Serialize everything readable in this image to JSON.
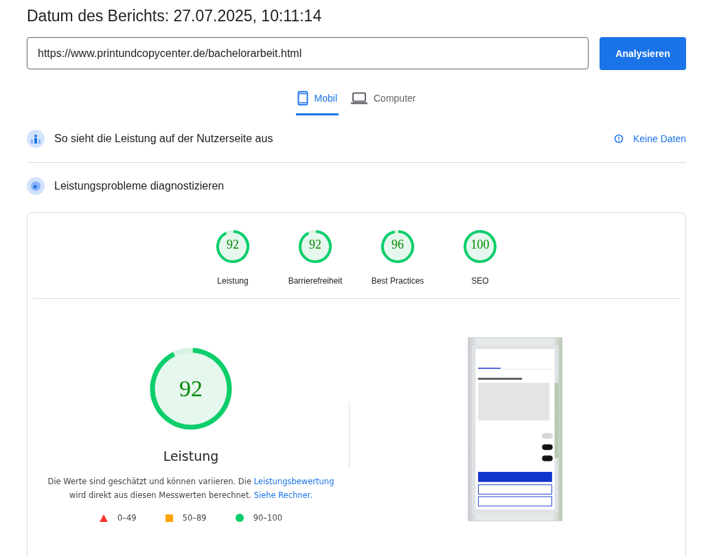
{
  "header": {
    "title": "Datum des Berichts: 27.07.2025, 10:11:14"
  },
  "url_field": {
    "value": "https://www.printundcopycenter.de/bachelorarbeit.html"
  },
  "analyze_button": {
    "label": "Analysieren"
  },
  "tabs": [
    {
      "label": "Mobil",
      "kind": "phone",
      "selected": true
    },
    {
      "label": "Computer",
      "kind": "laptop",
      "selected": false
    }
  ],
  "field_data": {
    "title": "So sieht die Leistung auf der Nutzerseite aus",
    "link": "Keine Daten"
  },
  "diagnostics": {
    "title": "Leistungsprobleme diagnostizieren",
    "categories": [
      {
        "score": "92",
        "label": "Leistung",
        "level": 0.92
      },
      {
        "score": "92",
        "label": "Barrierefreiheit",
        "level": 0.92
      },
      {
        "score": "96",
        "label": "Best Practices",
        "level": 0.96
      },
      {
        "score": "100",
        "label": "SEO",
        "level": 1
      }
    ],
    "main_gauge": {
      "score": "92",
      "label": "Leistung",
      "level": 0.92
    },
    "note": {
      "text": "Die Werte sind geschätzt und können variieren. Die",
      "link1": "Leistungsbewertung",
      "text2": "wird direkt aus diesen Messwerten berechnet.",
      "link2": "Siehe Rechner."
    },
    "legend": [
      {
        "kind": "fail",
        "range": "0–49"
      },
      {
        "kind": "average",
        "range": "50–89"
      },
      {
        "kind": "pass",
        "range": "90–100"
      }
    ]
  }
}
